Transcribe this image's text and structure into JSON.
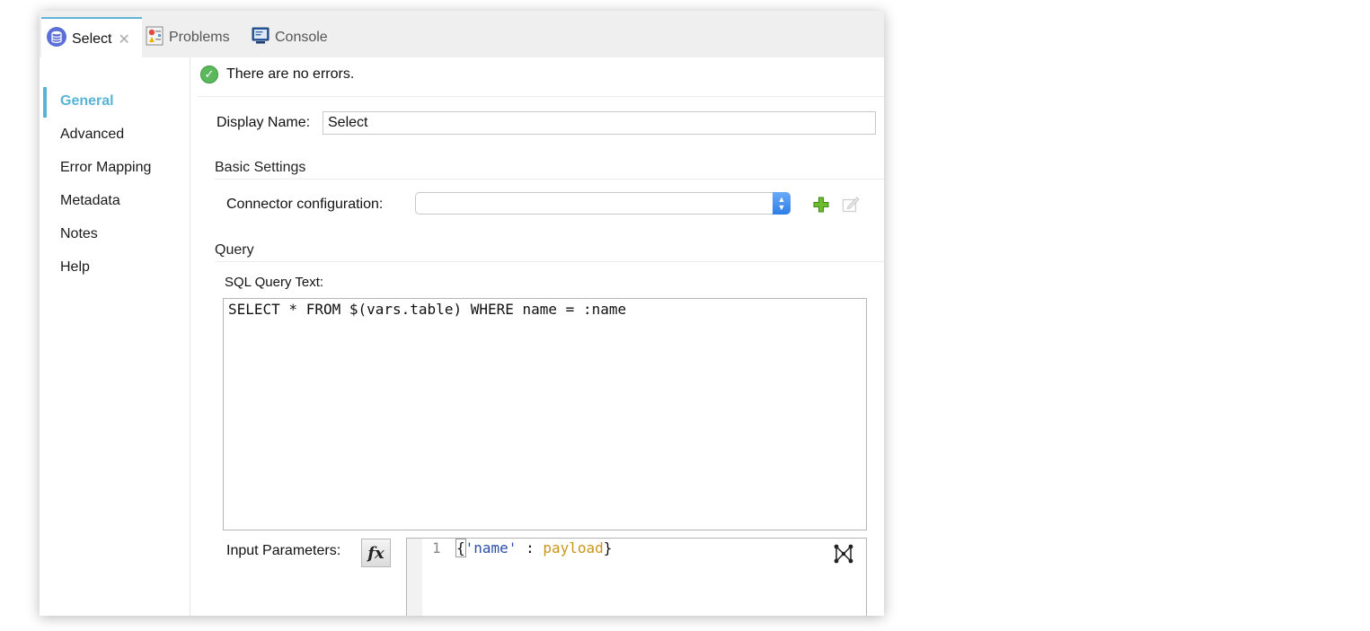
{
  "tabs": [
    {
      "label": "Select",
      "icon": "database-icon",
      "active": true
    },
    {
      "label": "Problems",
      "icon": "problems-icon",
      "active": false
    },
    {
      "label": "Console",
      "icon": "console-icon",
      "active": false
    }
  ],
  "sidebar": {
    "items": [
      {
        "label": "General",
        "active": true
      },
      {
        "label": "Advanced"
      },
      {
        "label": "Error Mapping"
      },
      {
        "label": "Metadata"
      },
      {
        "label": "Notes"
      },
      {
        "label": "Help"
      }
    ]
  },
  "status": {
    "text": "There are no errors.",
    "icon": "success-check-icon"
  },
  "general": {
    "display_name_label": "Display Name:",
    "display_name_value": "Select",
    "basic_settings_title": "Basic Settings",
    "connector_label": "Connector configuration:",
    "connector_value": "",
    "query_title": "Query",
    "sql_label": "SQL Query Text:",
    "sql_value": "SELECT * FROM $(vars.table) WHERE name = :name",
    "input_params_label": "Input Parameters:",
    "fx_label": "fx",
    "params_line_number": "1",
    "params_code": {
      "open": "{",
      "key": "'name'",
      "sep": " : ",
      "value": "payload",
      "close": "}"
    }
  },
  "colors": {
    "accent": "#58b4d6",
    "success": "#5cb85c",
    "code_string": "#2a4fa8",
    "code_keyword": "#c8961a"
  }
}
